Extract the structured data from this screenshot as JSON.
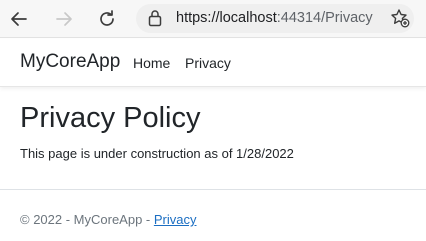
{
  "browser": {
    "url_host": "https://localhost",
    "url_rest": ":44314/Privacy"
  },
  "nav": {
    "brand": "MyCoreApp",
    "links": [
      "Home",
      "Privacy"
    ]
  },
  "main": {
    "title": "Privacy Policy",
    "text": "This page is under construction as of 1/28/2022"
  },
  "footer": {
    "prefix": "© 2022 - MyCoreApp - ",
    "link": "Privacy"
  },
  "colors": {
    "link": "#1b6ec2",
    "footer_text": "#6c757d"
  }
}
